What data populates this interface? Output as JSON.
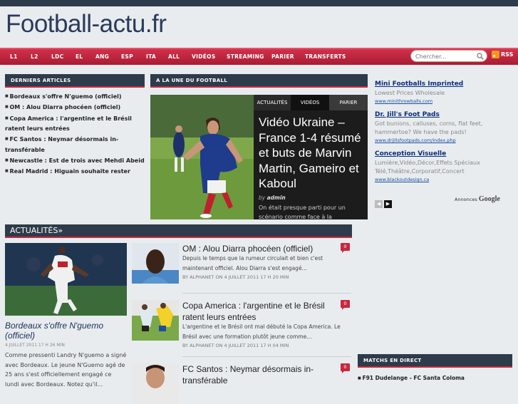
{
  "site": {
    "logo": "Football-actu.fr"
  },
  "nav": [
    "L1",
    "L2",
    "LDC",
    "EL",
    "ANG",
    "ESP",
    "ITA",
    "ALL",
    "VIDÉOS",
    "STREAMING",
    "PARIER",
    "TRANSFERTS"
  ],
  "search": {
    "placeholder": "Chercher..."
  },
  "rss": "RSS",
  "derniers": {
    "title": "DERNIERS ARTICLES",
    "items": [
      "Bordeaux s'offre N'guemo (officiel)",
      "OM : Alou Diarra phocéen (officiel)",
      "Copa America : l'argentine et le Brésil ratent leurs entrées",
      "FC Santos : Neymar désormais in-transférable",
      "Newcastle : Est de trois avec Mehdi Abeid",
      "Real Madrid : Higuain souhaite rester"
    ]
  },
  "une": {
    "title": "A LA UNE DU FOOTBALL",
    "tabs": [
      "ACTUALITÉS",
      "VIDÉOS",
      "PARIER"
    ],
    "headline": "Vidéo Ukraine – France 1-4 résumé et buts de Marvin Martin, Gameiro et Kaboul",
    "by_label": "by",
    "author": "admin",
    "excerpt": "On était presque parti pour un scénario comme face à la"
  },
  "ads": [
    {
      "title": "Mini Footballs Imprinted",
      "desc": "Lowest Prices Wholesale",
      "url": "www.minithrowballs.com"
    },
    {
      "title": "Dr. Jill's Foot Pads",
      "desc": "Got bunions, calluses, corns, flat feet, hammertoe? We have the pads!",
      "url": "www.drjillsfootpads.com/index.php"
    },
    {
      "title": "Conception Visuelle",
      "desc": "Lumière,Vidéo,Décor,Effets Spéciaux Télé,Théâtre,Corporatif,Concert",
      "url": "www.blackoutdesign.ca"
    }
  ],
  "annonces": {
    "label": "Annonces",
    "brand": "Google"
  },
  "actualites": {
    "title": "ACTUALITÉS»",
    "featured": {
      "title": "Bordeaux s'offre N'guemo (officiel)",
      "date": "4 JUILLET 2011 17 H 26 MIN",
      "excerpt": "Comme pressenti Landry N'guemo a signé avec Bordeaux. Le jeune N'Guemo agé de 25 ans s'est officiellement engagé ce lundi avec Bordeaux. Notez qu'il..."
    },
    "articles": [
      {
        "title": "OM : Alou Diarra phocéen (officiel)",
        "excerpt": "Depuis le temps que la rumeur circulait et bien c'est maintenant officiel. Alou Diarra s'est engagé...",
        "meta": "BY ALPHANET ON 4 JUILLET 2011 17 H 20 MIN",
        "comments": "0"
      },
      {
        "title": "Copa America : l'argentine et le Brésil ratent leurs entrées",
        "excerpt": "L'argentine et le Brésil ont mal débuté la Copa America. Le Brésil avec une formation plutôt jeune comme...",
        "meta": "BY ALPHANET ON 4 JUILLET 2011 17 H 04 MIN",
        "comments": "0"
      },
      {
        "title": "FC Santos : Neymar désormais in-transférable",
        "excerpt": "",
        "meta": "",
        "comments": "0"
      }
    ]
  },
  "matchs": {
    "title": "MATCHS EN DIRECT",
    "row": "F91 Dudelange - FC Santa Coloma"
  },
  "colors": {
    "accent": "#c8283f",
    "dark": "#2e3b4a",
    "link": "#0a2d7a"
  }
}
